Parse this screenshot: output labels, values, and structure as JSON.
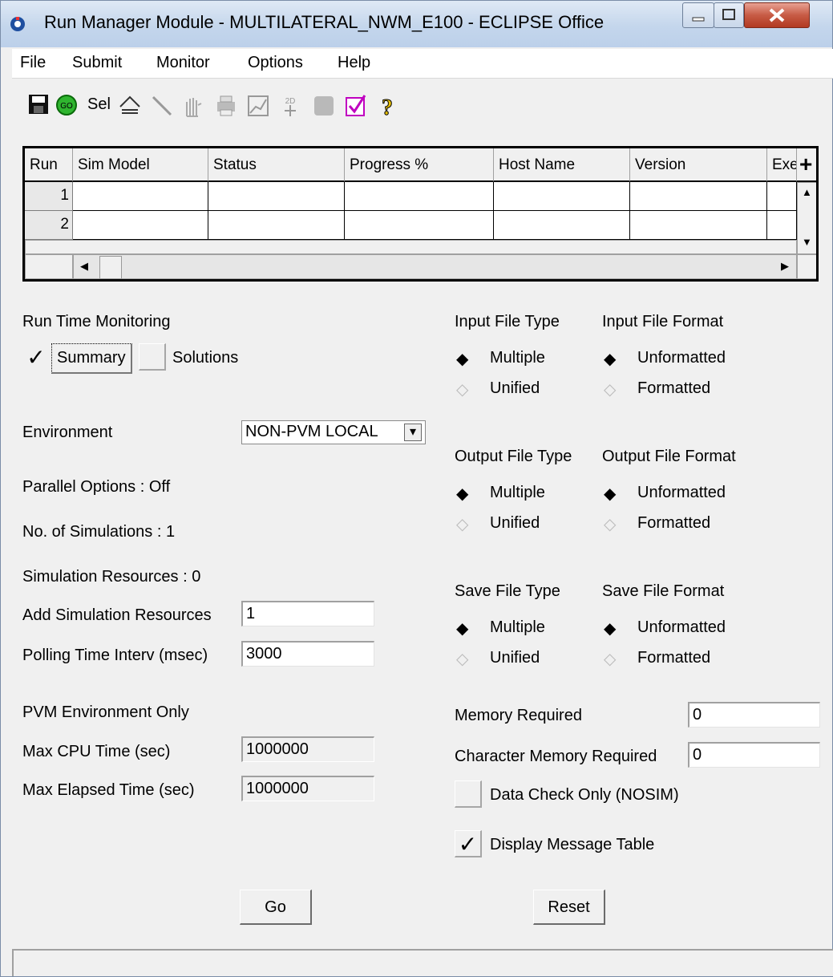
{
  "window": {
    "title": "Run Manager Module - MULTILATERAL_NWM_E100 - ECLIPSE Office"
  },
  "menubar": {
    "items": [
      "File",
      "Submit",
      "Monitor",
      "Options",
      "Help"
    ]
  },
  "toolbar": {
    "go_label": "GO",
    "sel_label": "Sel",
    "icons": [
      "save-icon",
      "go-icon",
      "sel-icon",
      "surface-icon",
      "line-icon",
      "hand-icon",
      "printer-icon",
      "graph-icon",
      "2d-3d-icon",
      "stop-icon",
      "checkmark-icon",
      "help-icon"
    ]
  },
  "grid": {
    "columns": [
      "Run",
      "Sim Model",
      "Status",
      "Progress %",
      "Host Name",
      "Version",
      "Exe"
    ],
    "plus_label": "+",
    "rows": [
      {
        "run": "1"
      },
      {
        "run": "2"
      }
    ]
  },
  "left": {
    "run_time_monitoring": "Run Time Monitoring",
    "summary_label": "Summary",
    "summary_checked": true,
    "solutions_label": "Solutions",
    "solutions_checked": false,
    "environment_label": "Environment",
    "environment_value": "NON-PVM LOCAL",
    "parallel_options": "Parallel Options : Off",
    "num_simulations": "No. of Simulations : 1",
    "sim_resources": "Simulation Resources : 0",
    "add_sim_resources_label": "Add Simulation Resources",
    "add_sim_resources_value": "1",
    "polling_label": "Polling Time Interv (msec)",
    "polling_value": "3000",
    "pvm_only": "PVM Environment Only",
    "max_cpu_label": "Max CPU Time (sec)",
    "max_cpu_value": "1000000",
    "max_elapsed_label": "Max Elapsed Time (sec)",
    "max_elapsed_value": "1000000"
  },
  "right": {
    "input_file_type": "Input File Type",
    "input_file_format": "Input File Format",
    "output_file_type": "Output File Type",
    "output_file_format": "Output File Format",
    "save_file_type": "Save File Type",
    "save_file_format": "Save File Format",
    "multiple": "Multiple",
    "unified": "Unified",
    "unformatted": "Unformatted",
    "formatted": "Formatted",
    "memory_label": "Memory Required",
    "memory_value": "0",
    "char_memory_label": "Character Memory Required",
    "char_memory_value": "0",
    "data_check_label": "Data Check Only (NOSIM)",
    "data_check_checked": false,
    "display_msg_label": "Display Message Table",
    "display_msg_checked": true
  },
  "buttons": {
    "go": "Go",
    "reset": "Reset"
  },
  "glyphs": {
    "check": "✓",
    "radio_on": "◆",
    "radio_off": "◇",
    "dropdown": "▾",
    "arrow_left": "◀",
    "arrow_right": "▶",
    "arrow_up": "▲",
    "arrow_down": "▼"
  },
  "colors": {
    "title_bg": "#c4d6ec",
    "close_btn": "#c75b45",
    "go_green": "#2fb52f",
    "check_magenta": "#c000c0"
  }
}
